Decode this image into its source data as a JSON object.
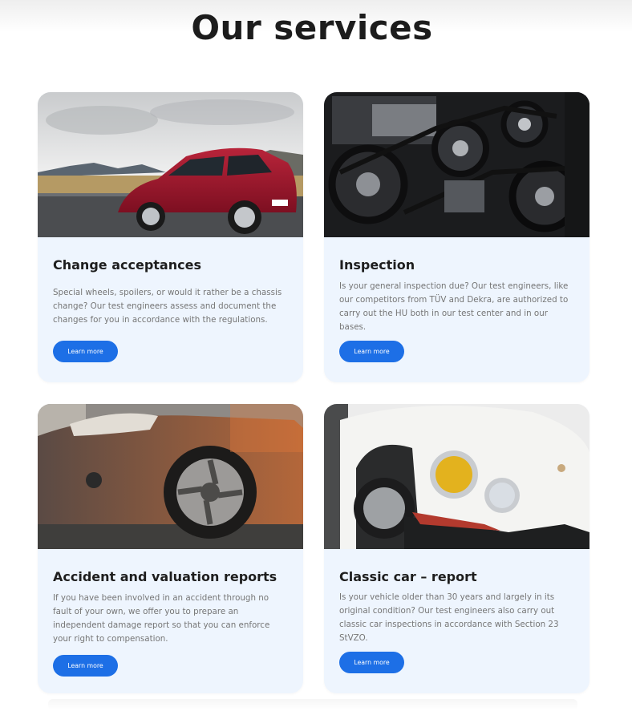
{
  "section": {
    "title": "Our services"
  },
  "cards": [
    {
      "title": "Change acceptances",
      "text": "Special wheels, spoilers, or would it rather be a chassis change? Our test engineers assess and document the changes for you in accordance with the regulations.",
      "button": "Learn more",
      "image_icon": "red-hatchback-car-photo"
    },
    {
      "title": "Inspection",
      "text": "Is your general inspection due? Our test engineers, like our competitors from TÜV and Dekra, are authorized to carry out the HU both in our test center and in our bases.",
      "button": "Learn more",
      "image_icon": "engine-belt-photo"
    },
    {
      "title": "Accident and valuation reports",
      "text": "If you have been involved in an accident through no fault of your own, we offer you to prepare an independent damage report so that you can enforce your right to compensation.",
      "button": "Learn more",
      "image_icon": "flat-tire-car-photo"
    },
    {
      "title": "Classic car – report",
      "text": "Is your vehicle older than 30 years and largely in its original condition? Our test engineers also carry out classic car inspections in accordance with Section 23 StVZO.",
      "button": "Learn more",
      "image_icon": "classic-white-car-photo"
    }
  ],
  "colors": {
    "card_background": "#eef5fe",
    "button": "#1d6fe6",
    "title": "#1e1e1e",
    "body_text": "#767676"
  }
}
